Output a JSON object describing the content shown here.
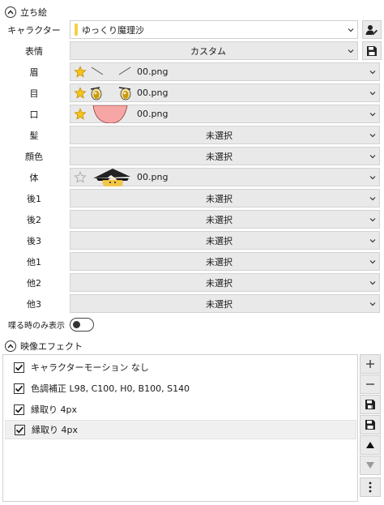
{
  "standing": {
    "title": "立ち絵",
    "character_label": "キャラクター",
    "character_value": "ゆっくり魔理沙",
    "character_accent": "#f5d04a",
    "expression_label": "表情",
    "expression_value": "カスタム",
    "parts": [
      {
        "label": "眉",
        "value": "00.png",
        "starred": true,
        "thumb": "eyebrows"
      },
      {
        "label": "目",
        "value": "00.png",
        "starred": true,
        "thumb": "eyes"
      },
      {
        "label": "口",
        "value": "00.png",
        "starred": true,
        "thumb": "mouth"
      },
      {
        "label": "髪",
        "value": "未選択",
        "starred": false,
        "thumb": ""
      },
      {
        "label": "顔色",
        "value": "未選択",
        "starred": false,
        "thumb": ""
      },
      {
        "label": "体",
        "value": "00.png",
        "starred": false,
        "star_outline": true,
        "thumb": "body"
      },
      {
        "label": "後1",
        "value": "未選択",
        "starred": false,
        "thumb": ""
      },
      {
        "label": "後2",
        "value": "未選択",
        "starred": false,
        "thumb": ""
      },
      {
        "label": "後3",
        "value": "未選択",
        "starred": false,
        "thumb": ""
      },
      {
        "label": "他1",
        "value": "未選択",
        "starred": false,
        "thumb": ""
      },
      {
        "label": "他2",
        "value": "未選択",
        "starred": false,
        "thumb": ""
      },
      {
        "label": "他3",
        "value": "未選択",
        "starred": false,
        "thumb": ""
      }
    ],
    "speak_only_label": "喋る時のみ表示",
    "speak_only_on": false
  },
  "effects": {
    "title": "映像エフェクト",
    "items": [
      {
        "label": "キャラクターモーション なし",
        "checked": true
      },
      {
        "label": "色調補正 L98, C100, H0, B100, S140",
        "checked": true
      },
      {
        "label": "縁取り 4px",
        "checked": true
      },
      {
        "label": "縁取り 4px",
        "checked": true,
        "selected": true
      }
    ],
    "tools": [
      "plus-icon",
      "minus-icon",
      "save-preset-icon",
      "save-icon",
      "move-up-icon",
      "move-down-icon",
      "more-icon"
    ]
  },
  "colors": {
    "star_fill": "#f5c518",
    "star_stroke": "#c58a00",
    "select_bg": "#e9e9e9"
  }
}
